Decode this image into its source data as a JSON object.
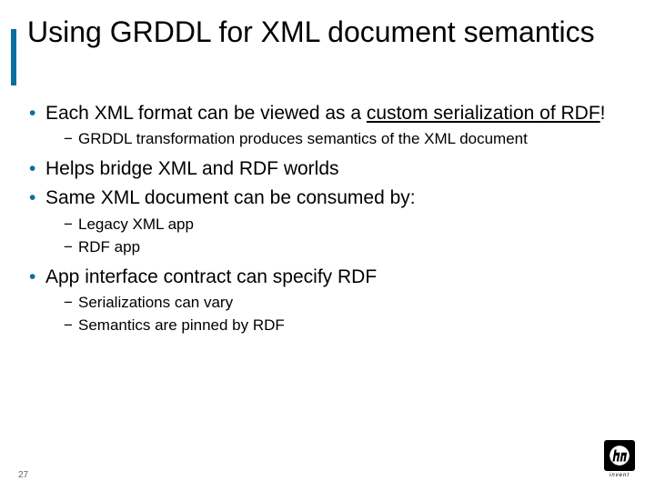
{
  "title": "Using GRDDL for XML document semantics",
  "bullets": [
    {
      "pre": "Each XML format can be viewed as a ",
      "link": "custom serialization of RDF",
      "post": "!",
      "sub": [
        "GRDDL transformation produces semantics of the XML document"
      ]
    },
    {
      "text": "Helps bridge XML and RDF worlds",
      "sub": []
    },
    {
      "text": "Same XML document can be consumed by:",
      "sub": [
        "Legacy XML app",
        "RDF app"
      ]
    },
    {
      "text": "App interface contract can specify RDF",
      "sub": [
        "Serializations can vary",
        "Semantics are pinned by RDF"
      ]
    }
  ],
  "page_number": "27",
  "logo_text": "invent"
}
